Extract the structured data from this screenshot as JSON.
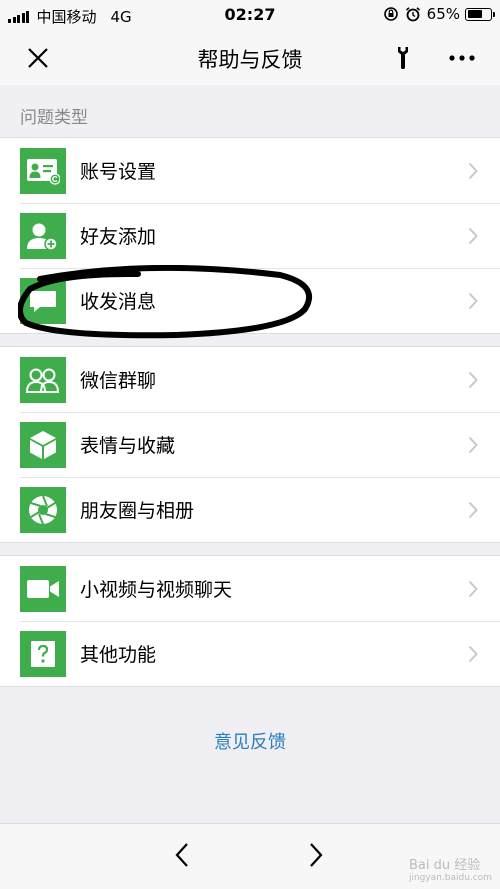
{
  "status_bar": {
    "carrier": "中国移动",
    "network": "4G",
    "time": "02:27",
    "battery_text": "65%",
    "battery_level": 0.65
  },
  "nav": {
    "title": "帮助与反馈",
    "icons": {
      "close": "close-icon",
      "tool": "wrench-icon",
      "more": "more-icon"
    }
  },
  "section": {
    "label": "问题类型"
  },
  "groups": [
    {
      "items": [
        {
          "label": "账号设置",
          "icon": "id-card-icon"
        },
        {
          "label": "好友添加",
          "icon": "add-friend-icon"
        },
        {
          "label": "收发消息",
          "icon": "chat-bubble-icon"
        }
      ]
    },
    {
      "items": [
        {
          "label": "微信群聊",
          "icon": "group-chat-icon"
        },
        {
          "label": "表情与收藏",
          "icon": "cube-icon"
        },
        {
          "label": "朋友圈与相册",
          "icon": "aperture-icon"
        }
      ]
    },
    {
      "items": [
        {
          "label": "小视频与视频聊天",
          "icon": "video-camera-icon"
        },
        {
          "label": "其他功能",
          "icon": "question-icon"
        }
      ]
    }
  ],
  "feedback": {
    "label": "意见反馈"
  },
  "watermark": {
    "text": "Bai du 经验",
    "sub": "jingyan.baidu.com"
  },
  "colors": {
    "accent": "#3fad4b",
    "link": "#2a7ebd",
    "background": "#efeff4"
  }
}
